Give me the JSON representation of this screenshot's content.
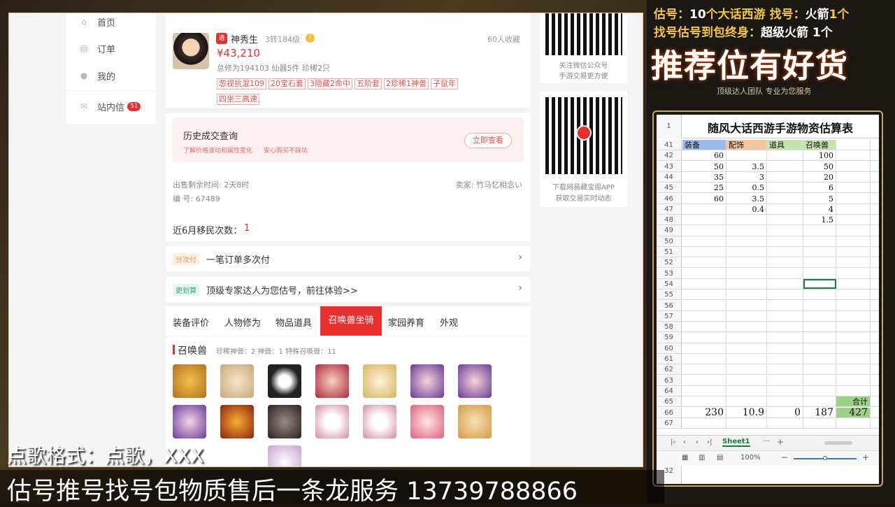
{
  "sidebar": {
    "items": [
      {
        "label": "首页",
        "icon": "home-icon"
      },
      {
        "label": "订单",
        "icon": "order-icon"
      },
      {
        "label": "我的",
        "icon": "user-icon"
      },
      {
        "label": "站内信",
        "icon": "mail-icon",
        "badge": "51"
      }
    ]
  },
  "listing": {
    "name": "神秀生",
    "level": "3转184级",
    "price": "¥43,210",
    "favorites": "60人收藏",
    "stats": "总修为194103  仙器5件  珍稀2只",
    "tags": [
      "忽视抗混109",
      "20宝石套",
      "3隐藏2命中",
      "五阶套",
      "2珍稀1神兽",
      "子鼠年",
      "四坐三高速"
    ]
  },
  "history": {
    "title": "历史成交查询",
    "desc1": "了解价格波动和属性变化",
    "desc2": "安心购买不踩坑",
    "button": "立即查看"
  },
  "sale_info": {
    "remaining": "出售剩余时间: 2天8时",
    "seller": "卖家: 竹马忆相念い",
    "code": "编  号: 67489"
  },
  "migration": {
    "label": "近6月移民次数：",
    "value": "1"
  },
  "installment": {
    "tag": "分次付",
    "text": "一笔订单多次付"
  },
  "expert": {
    "tag": "更划算",
    "text": "顶级专家达人为您估号，前往体验>>"
  },
  "tabs": [
    "装备评价",
    "人物修为",
    "物品道具",
    "召唤兽坐骑",
    "家园养育",
    "外观"
  ],
  "active_tab": 3,
  "pets": {
    "title": "召唤兽",
    "summary": "珍稀神兽：2   神兽：1   特殊召唤兽：11"
  },
  "qr": {
    "wechat": [
      "关注微信公众号",
      "手游交易更方便"
    ],
    "app": [
      "下载网易藏宝阁APP",
      "获取交易实时动态"
    ]
  },
  "banner": {
    "line1a": "估号：",
    "line1b": "10",
    "line1c": "个大话西游  找号：",
    "line1d": "火箭",
    "line1e": "1个",
    "line2a": "找号估号到包终身：",
    "line2b": "超级火箭 1个",
    "big": "推荐位有好货",
    "sub": "顶级达人团队  专业为您服务"
  },
  "spreadsheet": {
    "title": "随风大话西游手游物资估算表",
    "headers": [
      "装备",
      "配饰",
      "道具",
      "召唤兽"
    ],
    "rows": [
      {
        "n": "41",
        "cells": [
          "装备",
          "配饰",
          "道具",
          "召唤兽"
        ],
        "header": true
      },
      {
        "n": "42",
        "cells": [
          "60",
          "",
          "",
          "100"
        ]
      },
      {
        "n": "43",
        "cells": [
          "50",
          "3.5",
          "",
          "50"
        ]
      },
      {
        "n": "44",
        "cells": [
          "35",
          "3",
          "",
          "20"
        ]
      },
      {
        "n": "45",
        "cells": [
          "25",
          "0.5",
          "",
          "6"
        ]
      },
      {
        "n": "46",
        "cells": [
          "60",
          "3.5",
          "",
          "5"
        ]
      },
      {
        "n": "47",
        "cells": [
          "",
          "0.4",
          "",
          "4"
        ]
      },
      {
        "n": "48",
        "cells": [
          "",
          "",
          "",
          "1.5"
        ]
      },
      {
        "n": "49",
        "cells": [
          "",
          "",
          "",
          ""
        ]
      },
      {
        "n": "50",
        "cells": [
          "",
          "",
          "",
          ""
        ]
      },
      {
        "n": "51",
        "cells": [
          "",
          "",
          "",
          ""
        ]
      },
      {
        "n": "52",
        "cells": [
          "",
          "",
          "",
          ""
        ]
      },
      {
        "n": "53",
        "cells": [
          "",
          "",
          "",
          ""
        ]
      },
      {
        "n": "54",
        "cells": [
          "",
          "",
          "",
          ""
        ]
      },
      {
        "n": "55",
        "cells": [
          "",
          "",
          "",
          ""
        ]
      },
      {
        "n": "56",
        "cells": [
          "",
          "",
          "",
          ""
        ]
      },
      {
        "n": "57",
        "cells": [
          "",
          "",
          "",
          ""
        ]
      },
      {
        "n": "58",
        "cells": [
          "",
          "",
          "",
          ""
        ]
      },
      {
        "n": "59",
        "cells": [
          "",
          "",
          "",
          ""
        ]
      },
      {
        "n": "60",
        "cells": [
          "",
          "",
          "",
          ""
        ]
      },
      {
        "n": "61",
        "cells": [
          "",
          "",
          "",
          ""
        ]
      },
      {
        "n": "62",
        "cells": [
          "",
          "",
          "",
          ""
        ]
      },
      {
        "n": "63",
        "cells": [
          "",
          "",
          "",
          ""
        ]
      },
      {
        "n": "64",
        "cells": [
          "",
          "",
          "",
          ""
        ]
      },
      {
        "n": "65",
        "cells": [
          "",
          "",
          "",
          ""
        ],
        "total_label": "合计"
      },
      {
        "n": "66",
        "cells": [
          "230",
          "10.9",
          "0",
          "187"
        ],
        "total": "427"
      },
      {
        "n": "67",
        "cells": [
          "",
          "",
          "",
          ""
        ]
      }
    ],
    "sheet_tab": "Sheet1",
    "zoom": "100%",
    "extra_row": "32"
  },
  "overlay": {
    "song": "点歌格式：点歌，XXX",
    "service": "估号推号找号包物质售后一条龙服务 13739788866"
  },
  "colors": {
    "accent_red": "#e8302f",
    "gold": "#f3c648",
    "header_blue": "#9bbbe8",
    "header_orange": "#f4c6a0",
    "header_green": "#c7e3b0",
    "total_green": "#9fd08a"
  }
}
